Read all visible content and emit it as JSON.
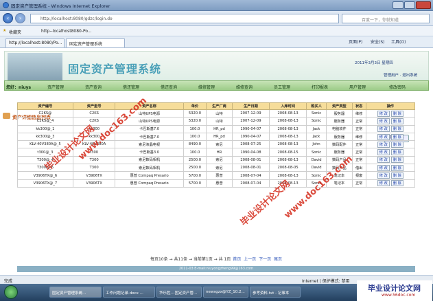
{
  "window": {
    "title": "固定资产管理系统 - Windows Internet Explorer"
  },
  "address": {
    "url": "http://localhost:8080/gdzc/login.do",
    "search_placeholder": "百度一下，你就知道"
  },
  "favorites": {
    "label": "收藏夹",
    "item": "http--localhost8080-Po..."
  },
  "tabs": [
    {
      "label": "http://localhost:8080/Po..."
    },
    {
      "label": "固定资产管理系统"
    }
  ],
  "ie_tools": {
    "page": "页面(P)",
    "safety": "安全(S)",
    "tools": "工具(O)"
  },
  "header": {
    "title": "固定资产管理系统",
    "date": "2011年3月3日  星期四",
    "user_links": "管理用户 · 退出系统"
  },
  "menu": {
    "greeting": "您好：niuys",
    "items": [
      "资产管理",
      "资产查询",
      "借还管理",
      "借还查询",
      "维修管理",
      "维修查询",
      "员工管理",
      "打印报表",
      "用户管理",
      "修改密码"
    ]
  },
  "section": {
    "title": "资产详细信息列表",
    "add_label": "添加资产"
  },
  "table": {
    "headers": [
      "资产编号",
      "资产型号",
      "资产名称",
      "单价",
      "生产厂商",
      "生产日期",
      "入库时间",
      "购买人",
      "资产类型",
      "状态",
      "操作"
    ],
    "rows": [
      [
        "C2KS@",
        "C2KS",
        "山特UPS电源",
        "5320.0",
        "山特",
        "2007-12-09",
        "2008-08-13",
        "Sonic",
        "服务器",
        "维修"
      ],
      [
        "C2KS@_4",
        "C2KS",
        "山特UPS电源",
        "5320.0",
        "山特",
        "2007-12-09",
        "2008-08-13",
        "Sonic",
        "服务器",
        "正常"
      ],
      [
        "kk300@_1",
        "kk300",
        "卡巴斯基7.0",
        "100.0",
        "HR_pd",
        "1990-04-07",
        "2008-08-13",
        "Jack",
        "电脑软件",
        "正常"
      ],
      [
        "kk300@_3",
        "kk300",
        "卡巴斯基7.0",
        "100.0",
        "HR_pd",
        "1990-04-07",
        "2008-08-13",
        "Jack",
        "服务器",
        "维修"
      ],
      [
        "KLV-40V380A@_5",
        "KLV-40V380A",
        "索尼液晶电视",
        "8490.0",
        "索尼",
        "2008-07-25",
        "2008-08-13",
        "John",
        "数码配件",
        "正常"
      ],
      [
        "t300@_3",
        "t300",
        "卡巴斯基3.0",
        "100.0",
        "HR",
        "1990-04-08",
        "2008-08-15",
        "Sonic",
        "服务器",
        "正常"
      ],
      [
        "T300@_4",
        "T300",
        "索尼数码相机",
        "2500.0",
        "索尼",
        "2008-08-01",
        "2008-08-13",
        "David",
        "数码产品",
        "正常"
      ],
      [
        "T300@_6",
        "T300",
        "索尼数码相机",
        "2500.0",
        "索尼",
        "2008-08-01",
        "2008-08-05",
        "David",
        "数码产品",
        "借出"
      ],
      [
        "V3906TX@_6",
        "V3906TX",
        "惠普 Compaq Presario",
        "5700.0",
        "惠普",
        "2008-07-04",
        "2008-08-13",
        "Sonic",
        "笔记本",
        "报废"
      ],
      [
        "V3906TX@_7",
        "V3906TX",
        "惠普 Compaq Presario",
        "5700.0",
        "惠普",
        "2008-07-04",
        "2008-08-13",
        "Sonic",
        "笔记本",
        "正常"
      ]
    ],
    "edit_label": "修 改",
    "delete_label": "删 除"
  },
  "pager": {
    "text": "每页10条 → 共11条 → 当前第1页 → 共 1页",
    "first": "首页",
    "prev": "上一页",
    "next": "下一页",
    "last": "尾页"
  },
  "footer": {
    "text": "2011-03 E-mail:niuyongzheng99@163.com"
  },
  "statusbar": {
    "left": "完成",
    "right": "Internet | 保护模式: 禁用"
  },
  "taskbar": {
    "items": [
      "固定资产管理系统...",
      "工作问题记录.docx ...",
      "华乐胜---固定资产管...",
      "newsgzx@YZ_10.2...",
      "参考资料.txt - 记事本"
    ]
  },
  "watermarks": [
    "毕业设计论文网",
    "www.doc163.com",
    "毕业设计论文网",
    "www.doc163.com"
  ],
  "brand": {
    "name": "毕业设计论文网",
    "url": "www.56doc.com"
  }
}
